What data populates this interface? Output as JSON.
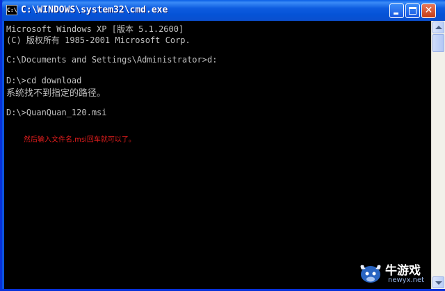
{
  "window": {
    "title": "C:\\WINDOWS\\system32\\cmd.exe",
    "app_icon_label": "C:\\"
  },
  "console": {
    "lines": [
      "Microsoft Windows XP [版本 5.1.2600]",
      "(C) 版权所有 1985-2001 Microsoft Corp.",
      "C:\\Documents and Settings\\Administrator>d:",
      "D:\\>cd download",
      "系统找不到指定的路径。",
      "D:\\>QuanQuan_120.msi"
    ],
    "annotation": "然后输入文件名.msi回车就可以了。"
  },
  "colors": {
    "text": "#c0c0c0",
    "annotation": "#e11d1d",
    "background": "#000000",
    "titlebar": "#0a53e0"
  },
  "watermark": {
    "brand": "牛游戏",
    "url": "newyx.net"
  }
}
